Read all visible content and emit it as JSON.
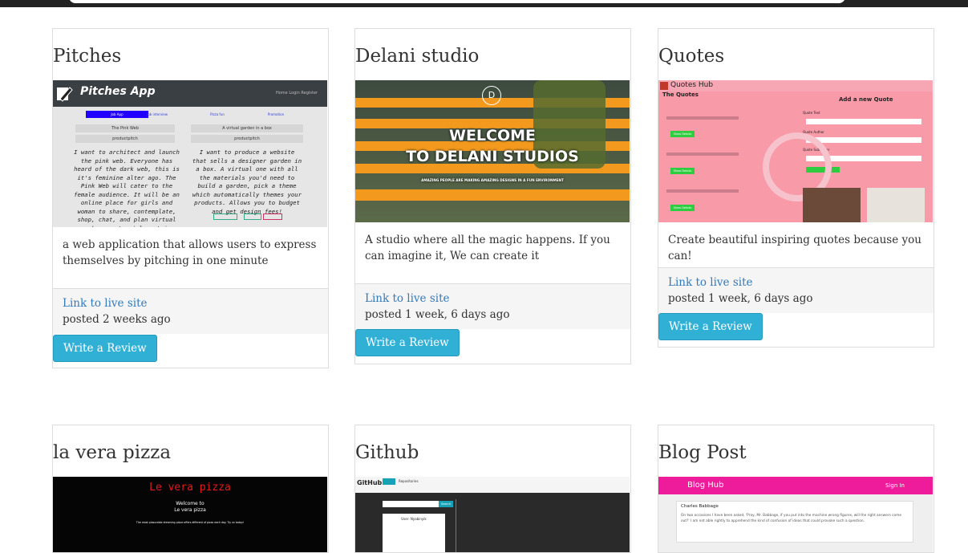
{
  "cards": [
    {
      "title": "Pitches",
      "description": "a web application that allows users to express themselves by pitching in one minute",
      "link": "Link to live site",
      "posted": "posted 2 weeks ago",
      "button": "Write a Review",
      "preview": {
        "logo": "Pitches App",
        "nav": "Home   Login   Register",
        "tabs": [
          "Job App",
          "Job interview",
          "Pizza fun",
          "Promotion"
        ],
        "box1_title": "The Pink Web",
        "box1_sub": "productpitch",
        "box2_title": "A virtual garden in a box",
        "box2_sub": "productpitch",
        "pitch1": "I want to architect and launch the pink web. Everyone has heard of the dark web, this is it's feminine alter ago. The Pink Web will cater to the female audience. It will be an online place for girls and woman to share, contemplate, shop, chat, and plan virtual and concrete girl centric things",
        "pitch2": "I want to produce a website that sells a designer garden in a box. A virtual one with all the materials you'd need to build a garden, pick a theme which automatically themes your products. Allows you to budget and get design fees!"
      }
    },
    {
      "title": "Delani studio",
      "description": "A studio where all the magic happens. If you can imagine it, We can create it",
      "link": "Link to live site",
      "posted": "posted 1 week, 6 days ago",
      "button": "Write a Review",
      "preview": {
        "badge": "D",
        "line1": "WELCOME",
        "line2": "TO DELANI STUDIOS",
        "tagline": "AMAZING PEOPLE ARE MAKING AMAZING DESIGNS IN A FUN ENVIRONMENT"
      }
    },
    {
      "title": "Quotes",
      "description": "Create beautiful inspiring quotes because you can!",
      "link": "Link to live site",
      "posted": "posted 1 week, 6 days ago",
      "button": "Write a Review",
      "preview": {
        "logo": "Quotes Hub",
        "heading": "The Quotes",
        "form_title": "Add a new Quote",
        "field1": "Quote Text",
        "field2": "Quote Author",
        "field3": "Quote Submitter",
        "show_details": "Show Details"
      }
    },
    {
      "title": "la vera pizza",
      "preview": {
        "logo": "Le vera pizza",
        "welcome1": "Welcome to",
        "welcome2": "Le vera pizza",
        "small": "The most plasurable dreaming place offers different of pizza each day. Try us today!"
      }
    },
    {
      "title": "Github",
      "preview": {
        "logo": "GitHub",
        "tab": "Repositories",
        "search": "Search",
        "user": "User: Nyabinyik"
      }
    },
    {
      "title": "Blog Post",
      "preview": {
        "logo": "Blog Hub",
        "signin": "Sign In",
        "author": "Charles Babbage",
        "quote": "On two occasions I have been asked, 'Pray, Mr. Babbage, if you put into the machine wrong figures, will the right answers come out?' I am not able rightly to apprehend the kind of confusion of ideas that could provoke such a question."
      }
    }
  ],
  "colors": {
    "link": "#337ab7",
    "button": "#31b0d5",
    "footer_bg": "#f5f5f5"
  }
}
